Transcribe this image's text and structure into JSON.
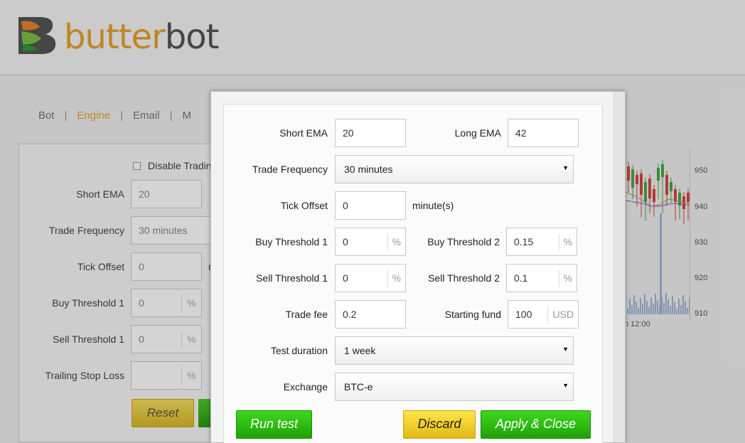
{
  "logo": {
    "part1": "butter",
    "part2": "bot"
  },
  "tabs": [
    "Bot",
    "Engine",
    "Email",
    "M"
  ],
  "bg_panel": {
    "disable_trading": "Disable Tradin",
    "rows": [
      {
        "label": "Short EMA",
        "value": "20"
      },
      {
        "label": "Trade Frequency",
        "value": "30 minutes"
      },
      {
        "label": "Tick Offset",
        "value": "0"
      },
      {
        "label": "Buy Threshold 1",
        "value": "0",
        "unit": "%"
      },
      {
        "label": "Sell Threshold 1",
        "value": "0",
        "unit": "%"
      },
      {
        "label": "Trailing Stop Loss",
        "value": "",
        "unit": "%"
      }
    ],
    "reset_label": "Reset",
    "tick_offset_suffix": "n"
  },
  "chart_data": {
    "type": "candlestick",
    "y_ticks": [
      "950",
      "940",
      "930",
      "920",
      "910"
    ],
    "x_tick": "n 12:00"
  },
  "modal": {
    "short_ema": {
      "label": "Short EMA",
      "value": "20"
    },
    "long_ema": {
      "label": "Long EMA",
      "value": "42"
    },
    "trade_frequency": {
      "label": "Trade Frequency",
      "value": "30 minutes"
    },
    "tick_offset": {
      "label": "Tick Offset",
      "value": "0",
      "suffix": "minute(s)"
    },
    "buy_threshold_1": {
      "label": "Buy Threshold 1",
      "value": "0",
      "unit": "%"
    },
    "buy_threshold_2": {
      "label": "Buy Threshold 2",
      "value": "0.15",
      "unit": "%"
    },
    "sell_threshold_1": {
      "label": "Sell Threshold 1",
      "value": "0",
      "unit": "%"
    },
    "sell_threshold_2": {
      "label": "Sell Threshold 2",
      "value": "0.1",
      "unit": "%"
    },
    "trade_fee": {
      "label": "Trade fee",
      "value": "0.2"
    },
    "starting_fund": {
      "label": "Starting fund",
      "value": "100",
      "unit": "USD"
    },
    "test_duration": {
      "label": "Test duration",
      "value": "1 week"
    },
    "exchange": {
      "label": "Exchange",
      "value": "BTC-e"
    },
    "buttons": {
      "run": "Run test",
      "discard": "Discard",
      "apply": "Apply & Close"
    }
  },
  "colors": {
    "accent": "#e8a02a",
    "green": "#2fbd12",
    "yellow": "#f0cc2a"
  }
}
